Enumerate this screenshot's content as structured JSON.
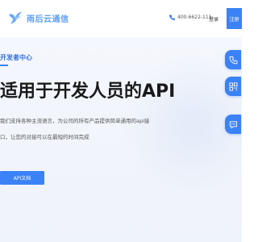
{
  "header": {
    "brand_name": "雨后云通信",
    "phone": "400-6622-111",
    "login_label": "登录",
    "register_label": "注册"
  },
  "hero": {
    "eyebrow": "开发者中心",
    "headline": "适用于开发人员的API",
    "description_line1": "我们支持各种主流语言，为公司的所有产品提供简单通用的api接",
    "description_line2": "口，让您的对接可以在最短的时间完成",
    "api_doc_button": "API文档"
  },
  "float_buttons": {
    "phone_icon": "phone-icon",
    "qr_icon": "qrcode-icon",
    "chat_icon": "chat-icon"
  },
  "colors": {
    "primary": "#3b82f6",
    "logo": "#5b9ff5",
    "headline": "#1a1a1a",
    "hero_bg": "#f2f5fb"
  }
}
